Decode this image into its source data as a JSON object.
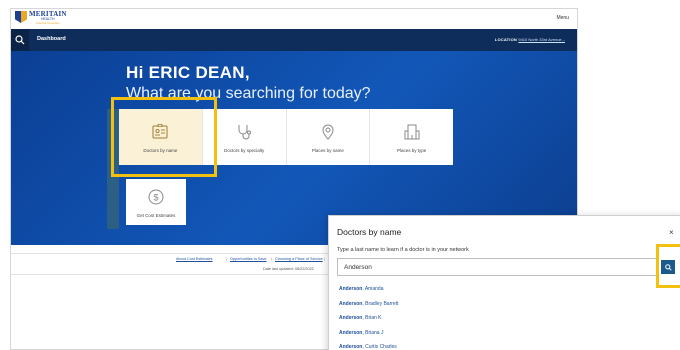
{
  "header": {
    "logo_name": "MERITAIN",
    "logo_sub": "HEALTH",
    "logo_sub2": "A Aetna Company",
    "menu_label": "Menu"
  },
  "nav": {
    "title": "Dashboard",
    "location_label": "LOCATION",
    "location_value": "9410 North 33rd Avenue..."
  },
  "hero": {
    "greeting": "Hi ERIC DEAN,",
    "question": "What are you searching for today?"
  },
  "tiles": [
    {
      "label": "Doctors by name",
      "icon": "id-card-icon"
    },
    {
      "label": "Doctors by specialty",
      "icon": "stethoscope-icon"
    },
    {
      "label": "Places by name",
      "icon": "map-pin-icon"
    },
    {
      "label": "Places by type",
      "icon": "building-icon"
    }
  ],
  "cost_tile": {
    "label": "Get Cost Estimates",
    "icon": "dollar-icon"
  },
  "footer": {
    "links": [
      "About Cost Estimates",
      "Opportunities to Save",
      "Choosing a Place of Service",
      "Health"
    ],
    "updated": "Date last updated: 08/22/2022"
  },
  "modal": {
    "title": "Doctors by name",
    "close": "×",
    "hint": "Type a last name to learn if a doctor is in your network",
    "search_value": "Anderson",
    "results": [
      {
        "match": "Anderson",
        "rest": ", Amanda"
      },
      {
        "match": "Anderson",
        "rest": ", Bradley Barrett"
      },
      {
        "match": "Anderson",
        "rest": ", Brian K"
      },
      {
        "match": "Anderson",
        "rest": ", Briana J"
      },
      {
        "match": "Anderson",
        "rest": ", Curtis Charles"
      }
    ]
  },
  "colors": {
    "navy": "#0f2d5a",
    "hero_blue": "#1257b8",
    "highlight": "#f2c110",
    "link_blue": "#1f4f9f"
  }
}
